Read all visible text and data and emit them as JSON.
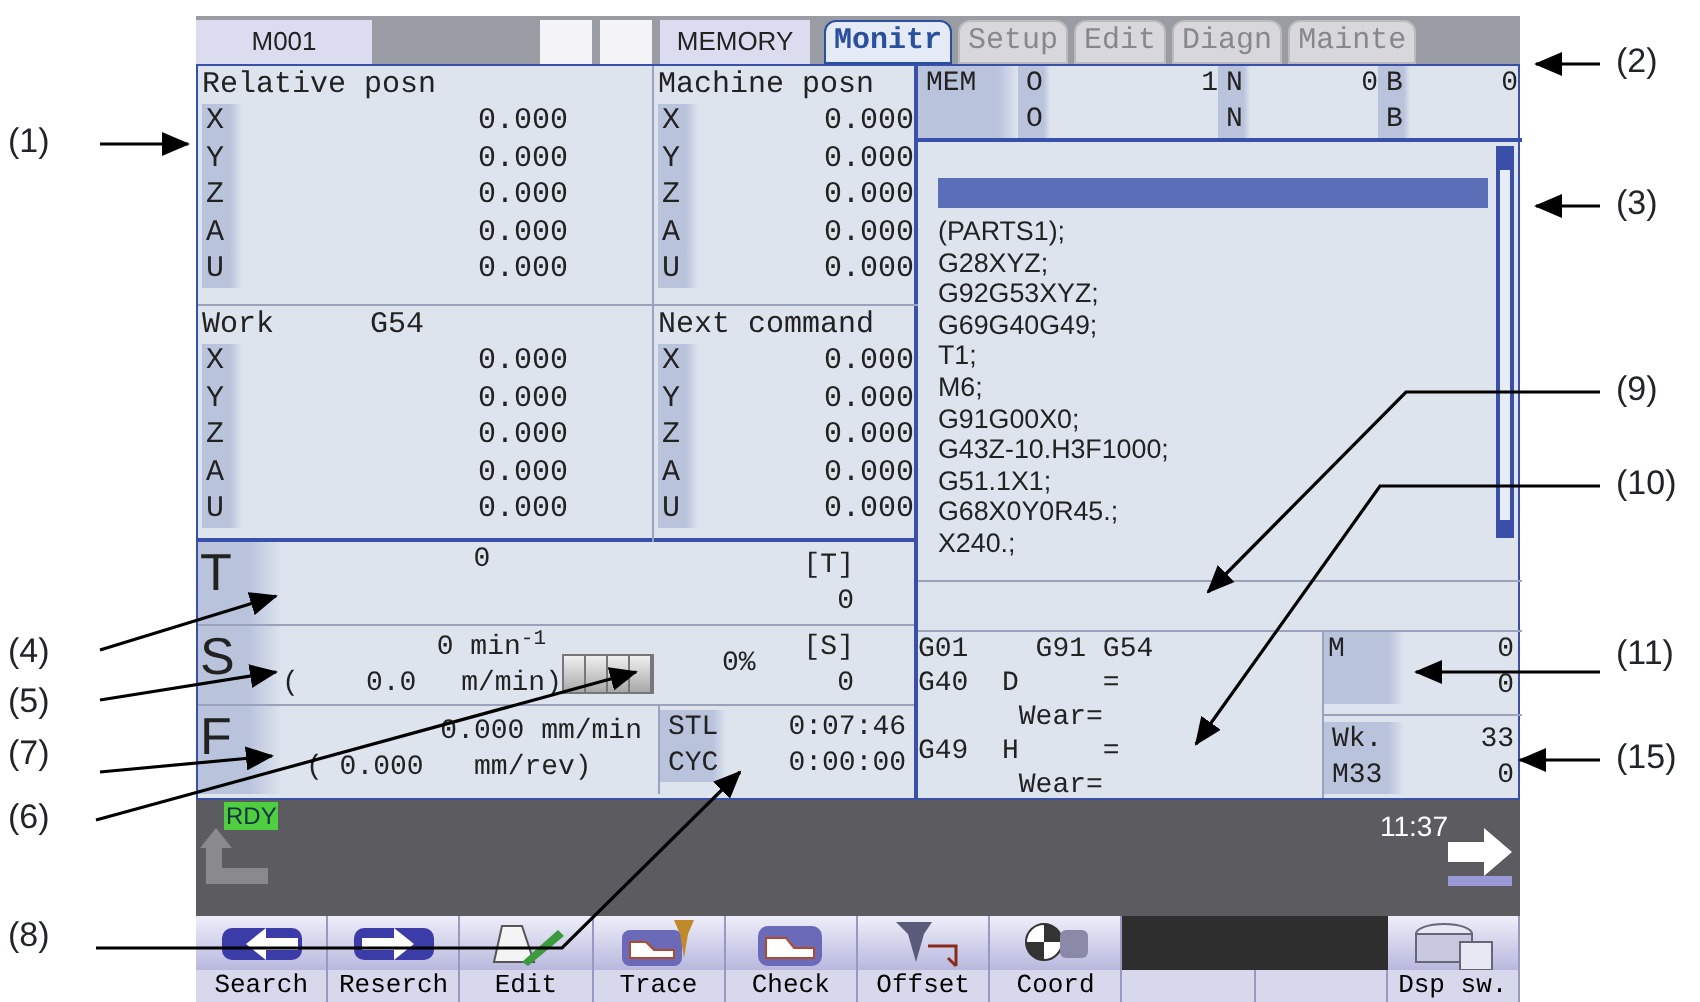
{
  "header": {
    "machine": "M001",
    "mode": "MEMORY"
  },
  "tabs": [
    {
      "label": "Monitr",
      "selected": true
    },
    {
      "label": "Setup",
      "selected": false
    },
    {
      "label": "Edit",
      "selected": false
    },
    {
      "label": "Diagn",
      "selected": false
    },
    {
      "label": "Mainte",
      "selected": false
    }
  ],
  "positions": [
    {
      "title": "Relative posn",
      "rows": [
        {
          "axis": "X",
          "value": "0.000"
        },
        {
          "axis": "Y",
          "value": "0.000"
        },
        {
          "axis": "Z",
          "value": "0.000"
        },
        {
          "axis": "A",
          "value": "0.000"
        },
        {
          "axis": "U",
          "value": "0.000"
        }
      ]
    },
    {
      "title": "Machine posn",
      "rows": [
        {
          "axis": "X",
          "value": "0.000"
        },
        {
          "axis": "Y",
          "value": "0.000"
        },
        {
          "axis": "Z",
          "value": "0.000"
        },
        {
          "axis": "A",
          "value": "0.000"
        },
        {
          "axis": "U",
          "value": "0.000"
        }
      ]
    },
    {
      "title": "Work",
      "subtitle": "G54",
      "rows": [
        {
          "axis": "X",
          "value": "0.000"
        },
        {
          "axis": "Y",
          "value": "0.000"
        },
        {
          "axis": "Z",
          "value": "0.000"
        },
        {
          "axis": "A",
          "value": "0.000"
        },
        {
          "axis": "U",
          "value": "0.000"
        }
      ]
    },
    {
      "title": "Next command",
      "rows": [
        {
          "axis": "X",
          "value": "0.000"
        },
        {
          "axis": "Y",
          "value": "0.000"
        },
        {
          "axis": "Z",
          "value": "0.000"
        },
        {
          "axis": "A",
          "value": "0.000"
        },
        {
          "axis": "U",
          "value": "0.000"
        }
      ]
    }
  ],
  "program_header": {
    "mode": "MEM",
    "rows": [
      [
        {
          "label": "O",
          "value": "1"
        },
        {
          "label": "N",
          "value": "0"
        },
        {
          "label": "B",
          "value": "0"
        }
      ],
      [
        {
          "label": "O"
        },
        {
          "label": "N"
        },
        {
          "label": "B"
        }
      ]
    ]
  },
  "program": {
    "lines": [
      "(PARTS1);",
      "G28XYZ;",
      "G92G53XYZ;",
      "G69G40G49;",
      "T1;",
      "M6;",
      "G91G00X0;",
      "G43Z-10.H3F1000;",
      "G51.1X1;",
      "G68X0Y0R45.;",
      "X240.;"
    ]
  },
  "tool": {
    "label": "T",
    "value": "0",
    "bracket": "[T]",
    "bracket_value": "0"
  },
  "spindle": {
    "label": "S",
    "speed": "0 min$^{-1}$",
    "surface": "(    0.0",
    "surface_unit": "m/min)",
    "load_meter": {
      "level": 0
    },
    "load": "0%",
    "bracket": "[S]",
    "bracket_value": "0"
  },
  "feed": {
    "label": "F",
    "rate": "0.000 mm/min",
    "per_rev": "( 0.000   mm/rev)"
  },
  "times": [
    {
      "label": "STL",
      "value": "0:07:46"
    },
    {
      "label": "CYC",
      "value": "0:00:00"
    }
  ],
  "modal": {
    "lines": [
      "G01    G91 G54",
      "G40  D     =",
      "      Wear=",
      "G49  H     =",
      "      Wear="
    ]
  },
  "m_codes": {
    "label": "M",
    "values": [
      "0",
      "0"
    ]
  },
  "work_count": {
    "labels": [
      "Wk.",
      "M33"
    ],
    "values": [
      "33",
      "0"
    ]
  },
  "status": {
    "ready": "RDY",
    "time": "11:37"
  },
  "softkeys": [
    {
      "kind": "search",
      "label": "Search"
    },
    {
      "kind": "research",
      "label": "Reserch"
    },
    {
      "kind": "edit",
      "label": "Edit"
    },
    {
      "kind": "trace",
      "label": "Trace"
    },
    {
      "kind": "check",
      "label": "Check"
    },
    {
      "kind": "offset",
      "label": "Offset"
    },
    {
      "kind": "coord",
      "label": "Coord"
    },
    {
      "kind": "blank"
    },
    {
      "kind": "blank"
    },
    {
      "kind": "display",
      "label": "Dsp sw."
    }
  ],
  "callouts": [
    {
      "label": "(2)"
    },
    {
      "label": "(1)"
    },
    {
      "label": "(3)"
    },
    {
      "label": "(9)"
    },
    {
      "label": "(10)"
    },
    {
      "label": "(4)"
    },
    {
      "label": "(11)"
    },
    {
      "label": "(5)"
    },
    {
      "label": "(7)"
    },
    {
      "label": "(15)"
    },
    {
      "label": "(6)"
    },
    {
      "label": "(8)"
    }
  ]
}
